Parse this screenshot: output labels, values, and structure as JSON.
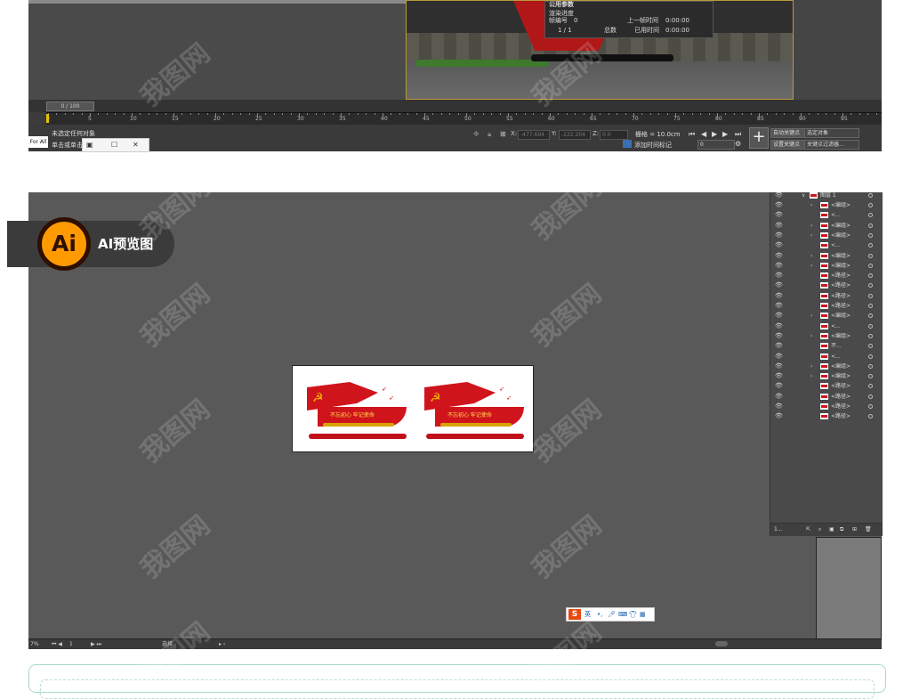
{
  "max": {
    "render_panel": {
      "title": "公用参数",
      "progress_label": "渲染进度",
      "frame_no_label": "帧编号",
      "frame_no": "0",
      "frames": "1 / 1",
      "total_label": "总数",
      "last_frame_label": "上一帧时间",
      "last_frame_time": "0:00:00",
      "elapsed_label": "已用时间",
      "elapsed_time": "0:00:00"
    },
    "frame_slider": "0 / 100",
    "ruler_ticks": [
      "0",
      "5",
      "10",
      "15",
      "20",
      "25",
      "30",
      "35",
      "40",
      "45",
      "50",
      "55",
      "60",
      "65",
      "70",
      "75",
      "80",
      "85",
      "90",
      "95"
    ],
    "status_line1": "未选定任何对象",
    "status_line2": "单击或单击",
    "maxscript_label": "For All",
    "coord_x_label": "X:",
    "coord_x": "-477.694",
    "coord_y_label": "Y:",
    "coord_y": "-222.204",
    "coord_z_label": "Z:",
    "coord_z": "0.0",
    "grid_label": "栅格 = 10.0cm",
    "add_time_tag": "添加时间标记",
    "auto_key": "自动关键点",
    "selected_object": "选定对象",
    "set_key": "设置关键点",
    "key_filter": "关键点过滤器...",
    "frame_field": "0"
  },
  "ai": {
    "badge_logo": "Ai",
    "badge_label": "AI预览图",
    "sign": {
      "slogan": "不忘初心 牢记使命"
    },
    "layers": {
      "top_layer": "图层 1",
      "rows": [
        {
          "name": "<编组>",
          "arrow": true
        },
        {
          "name": "<...",
          "arrow": false
        },
        {
          "name": "<编组>",
          "arrow": true
        },
        {
          "name": "<编组>",
          "arrow": true
        },
        {
          "name": "<...",
          "arrow": false
        },
        {
          "name": "<编组>",
          "arrow": true
        },
        {
          "name": "<编组>",
          "arrow": true
        },
        {
          "name": "<路径>",
          "arrow": false
        },
        {
          "name": "<路径>",
          "arrow": false
        },
        {
          "name": "<路径>",
          "arrow": false
        },
        {
          "name": "<路径>",
          "arrow": false
        },
        {
          "name": "<编组>",
          "arrow": true
        },
        {
          "name": "<...",
          "arrow": false
        },
        {
          "name": "<编组>",
          "arrow": true
        },
        {
          "name": "不...",
          "arrow": false
        },
        {
          "name": "<...",
          "arrow": false
        },
        {
          "name": "<编组>",
          "arrow": true
        },
        {
          "name": "<编组>",
          "arrow": true
        },
        {
          "name": "<路径>",
          "arrow": false
        },
        {
          "name": "<路径>",
          "arrow": false
        },
        {
          "name": "<路径>",
          "arrow": false
        },
        {
          "name": "<路径>",
          "arrow": false
        }
      ],
      "footer_count": "1..."
    },
    "ime_label": "英",
    "status": {
      "zoom": "7%",
      "page": "1",
      "tool": "选择"
    }
  },
  "watermark": "我图网"
}
